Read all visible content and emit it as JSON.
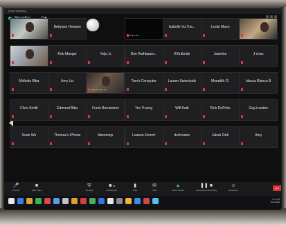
{
  "window": {
    "title": "Zoom Meeting"
  },
  "recording": {
    "label": "Recording...",
    "controls": "II  ■"
  },
  "tiles": [
    {
      "name": "",
      "sub": "",
      "kind": "video-a"
    },
    {
      "name": "Bettyann Hewson",
      "sub": "",
      "kind": "plain"
    },
    {
      "name": "",
      "sub": "iPhone (Coben)",
      "kind": "ball"
    },
    {
      "name": "",
      "sub": "Tedjun Wu",
      "kind": "black"
    },
    {
      "name": "Isabelle Vu Tria...",
      "sub": "",
      "kind": "plain"
    },
    {
      "name": "Leslie Mann",
      "sub": "",
      "kind": "plain"
    },
    {
      "name": "",
      "sub": "",
      "kind": "video-b"
    },
    {
      "name": "",
      "sub": "",
      "kind": "video-c"
    },
    {
      "name": "Rob Manger",
      "sub": "",
      "kind": "plain"
    },
    {
      "name": "Yojiu Li",
      "sub": "",
      "kind": "plain"
    },
    {
      "name": "Don Rathbauer...",
      "sub": "",
      "kind": "plain"
    },
    {
      "name": "KKirkbride",
      "sub": "",
      "kind": "plain"
    },
    {
      "name": "Jasmine",
      "sub": "",
      "kind": "plain"
    },
    {
      "name": "J chan",
      "sub": "",
      "kind": "plain"
    },
    {
      "name": "Mirlinda Biba",
      "sub": "",
      "kind": "plain"
    },
    {
      "name": "Amy Liu",
      "sub": "",
      "kind": "plain"
    },
    {
      "name": "",
      "sub": "Hong Ronnie Xu",
      "kind": "video-d"
    },
    {
      "name": "Tom's Computer",
      "sub": "",
      "kind": "plain"
    },
    {
      "name": "Lauren Swiecinski",
      "sub": "",
      "kind": "plain"
    },
    {
      "name": "Meradith O.",
      "sub": "",
      "kind": "plain"
    },
    {
      "name": "blanca Blanca B",
      "sub": "",
      "kind": "plain"
    },
    {
      "name": "Chris Smith",
      "sub": "",
      "kind": "plain"
    },
    {
      "name": "Edmond Biba",
      "sub": "",
      "kind": "plain"
    },
    {
      "name": "Frank Bernardoni",
      "sub": "",
      "kind": "plain"
    },
    {
      "name": "Ten Truong",
      "sub": "",
      "kind": "plain"
    },
    {
      "name": "Will Kaitt",
      "sub": "",
      "kind": "plain"
    },
    {
      "name": "Rich DePinto",
      "sub": "",
      "kind": "plain"
    },
    {
      "name": "Gay.Lowden",
      "sub": "",
      "kind": "plain"
    },
    {
      "name": "Sean Wu",
      "sub": "",
      "kind": "plain"
    },
    {
      "name": "Thomas's iPhone",
      "sub": "",
      "kind": "plain"
    },
    {
      "name": "bbeumejs",
      "sub": "",
      "kind": "plain"
    },
    {
      "name": "Leanne Ermert",
      "sub": "",
      "kind": "plain"
    },
    {
      "name": "dschwane",
      "sub": "",
      "kind": "plain"
    },
    {
      "name": "Jakub Dzik",
      "sub": "",
      "kind": "plain"
    },
    {
      "name": "Amy",
      "sub": "",
      "kind": "plain"
    }
  ],
  "toolbar": {
    "unmute": {
      "icon": "mic-off-icon",
      "label": "Unmute"
    },
    "video": {
      "icon": "video-off-icon",
      "label": "Start Video"
    },
    "security": {
      "icon": "shield-icon",
      "label": "Security"
    },
    "participants": {
      "icon": "people-icon",
      "label": "Participants",
      "count": "35"
    },
    "polls": {
      "icon": "bar-chart-icon",
      "label": "Polls"
    },
    "chat": {
      "icon": "chat-icon",
      "label": "Chat"
    },
    "share": {
      "icon": "share-screen-icon",
      "label": "Share Screen"
    },
    "record": {
      "icon": "pause-stop-icon",
      "label": "Pause/Stop Recording"
    },
    "reactions": {
      "icon": "smile-icon",
      "label": "Reactions"
    },
    "leave": {
      "label": "End"
    }
  },
  "taskbar": {
    "clock": "7:07 PM",
    "date": "9/21/2020",
    "colors": [
      "#e8e8e8",
      "#3c7de0",
      "#d9a23a",
      "#3bb54a",
      "#e04848",
      "#4fa0e8",
      "#c3c3c3",
      "#e0a030",
      "#d04040",
      "#4cae55",
      "#2f77d4",
      "#e5e5e5",
      "#8a8a8a",
      "#f2b33d",
      "#3a8ee6",
      "#d14b3c",
      "#5cbcea"
    ]
  }
}
